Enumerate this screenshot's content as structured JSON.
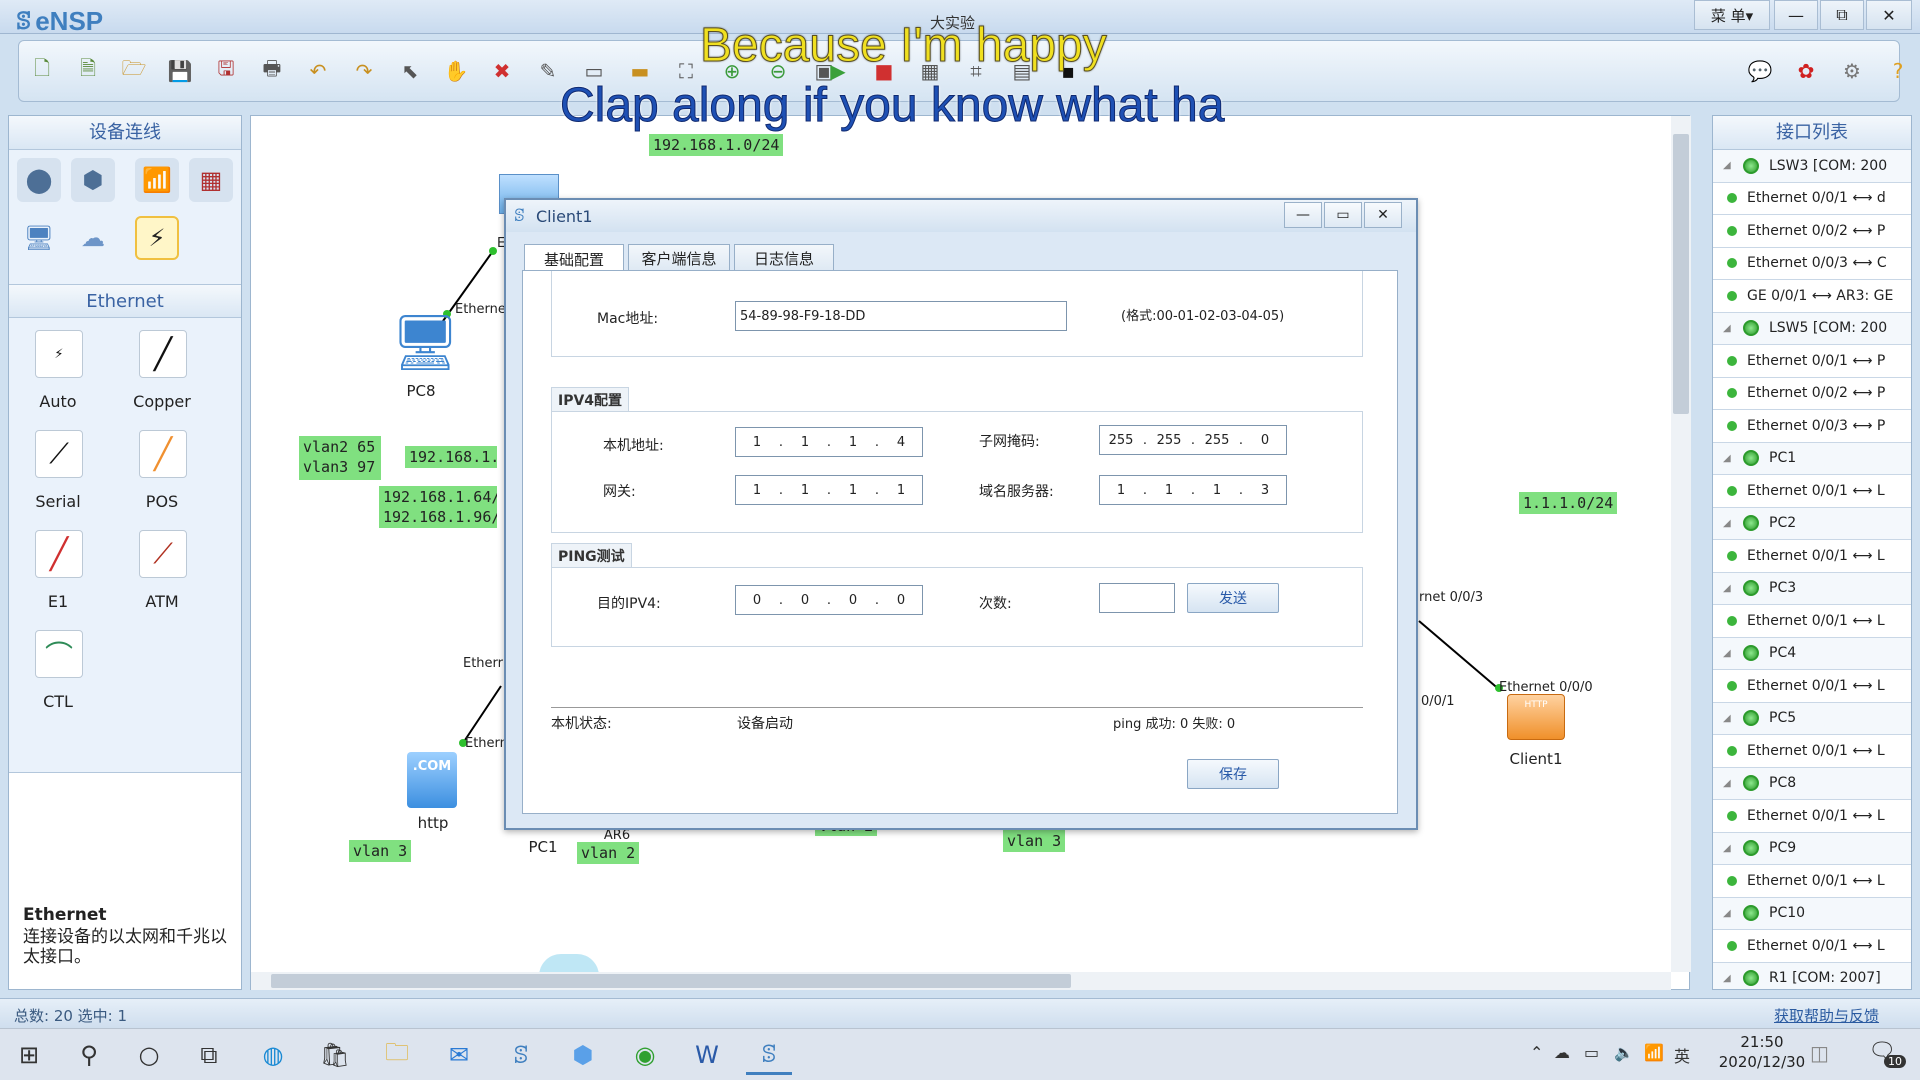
{
  "app": {
    "name": "eNSP",
    "window_title": "大实验",
    "menu_label": "菜 单▾"
  },
  "subtitles": {
    "line1": "Because I'm happy",
    "line2": "Clap along if you know what ha"
  },
  "left_panel": {
    "devices_title": "设备连线",
    "devices": [
      {
        "name": "router-icon"
      },
      {
        "name": "switch-icon"
      },
      {
        "name": "wireless-icon"
      },
      {
        "name": "firewall-icon"
      },
      {
        "name": "pc-icon"
      },
      {
        "name": "cloud-icon"
      },
      {
        "name": "cable-icon"
      }
    ],
    "cables_title": "Ethernet",
    "cables": [
      "Auto",
      "Copper",
      "Serial",
      "POS",
      "E1",
      "ATM",
      "CTL"
    ],
    "desc_title": "Ethernet",
    "desc_text": "连接设备的以太网和千兆以太接口。"
  },
  "canvas": {
    "labels": {
      "net_top": "192.168.1.0/24",
      "vlan_a": "vlan2 65",
      "vlan_b": "vlan3 97",
      "ip_mid": "192.168.1.",
      "ip_64": "192.168.1.64/",
      "ip_96": "192.168.1.96/",
      "net_right": "1.1.1.0/24",
      "vlan3_left": "vlan 3",
      "vlan2_bottom": "vlan 2",
      "vlan2_partial": "vlan 2",
      "vlan3_mid": "vlan 3"
    },
    "nodes": {
      "pc8": "PC8",
      "http": "http",
      "pc1": "PC1",
      "ar6": "AR6",
      "client1": "Client1",
      "http_badge": "HTTP",
      "com_badge": ".COM"
    },
    "ports": {
      "p1": "Etherne",
      "p2": "Etherr",
      "p3": "Ethern",
      "p4": "rnet 0/0/3",
      "p5": "Ethernet 0/0/0",
      "p6": "0/0/1",
      "p7": "E"
    }
  },
  "dialog": {
    "title": "Client1",
    "tabs": [
      "基础配置",
      "客户端信息",
      "日志信息"
    ],
    "mac_label": "Mac地址:",
    "mac_value": "54-89-98-F9-18-DD",
    "mac_hint": "(格式:00-01-02-03-04-05)",
    "ipv4_title": "IPV4配置",
    "ip_label": "本机地址:",
    "ip_value": [
      "1",
      "1",
      "1",
      "4"
    ],
    "mask_label": "子网掩码:",
    "mask_value": [
      "255",
      "255",
      "255",
      "0"
    ],
    "gw_label": "网关:",
    "gw_value": [
      "1",
      "1",
      "1",
      "1"
    ],
    "dns_label": "域名服务器:",
    "dns_value": [
      "1",
      "1",
      "1",
      "3"
    ],
    "ping_title": "PING测试",
    "target_label": "目的IPV4:",
    "target_value": [
      "0",
      "0",
      "0",
      "0"
    ],
    "count_label": "次数:",
    "count_value": "",
    "send_label": "发送",
    "status_label": "本机状态:",
    "status_value": "设备启动",
    "ping_result": "ping 成功: 0  失败: 0",
    "save_label": "保存"
  },
  "right_panel": {
    "title": "接口列表",
    "items": [
      {
        "type": "device",
        "label": "LSW3 [COM: 200"
      },
      {
        "type": "port",
        "label": "Ethernet 0/0/1  ⟷  d"
      },
      {
        "type": "port",
        "label": "Ethernet 0/0/2  ⟷  P"
      },
      {
        "type": "port",
        "label": "Ethernet 0/0/3  ⟷  C"
      },
      {
        "type": "port",
        "label": "GE 0/0/1  ⟷  AR3: GE"
      },
      {
        "type": "device",
        "label": "LSW5 [COM: 200"
      },
      {
        "type": "port",
        "label": "Ethernet 0/0/1  ⟷  P"
      },
      {
        "type": "port",
        "label": "Ethernet 0/0/2  ⟷  P"
      },
      {
        "type": "port",
        "label": "Ethernet 0/0/3  ⟷  P"
      },
      {
        "type": "device",
        "label": "PC1"
      },
      {
        "type": "port",
        "label": "Ethernet 0/0/1  ⟷  L"
      },
      {
        "type": "device",
        "label": "PC2"
      },
      {
        "type": "port",
        "label": "Ethernet 0/0/1  ⟷  L"
      },
      {
        "type": "device",
        "label": "PC3"
      },
      {
        "type": "port",
        "label": "Ethernet 0/0/1  ⟷  L"
      },
      {
        "type": "device",
        "label": "PC4"
      },
      {
        "type": "port",
        "label": "Ethernet 0/0/1  ⟷  L"
      },
      {
        "type": "device",
        "label": "PC5"
      },
      {
        "type": "port",
        "label": "Ethernet 0/0/1  ⟷  L"
      },
      {
        "type": "device",
        "label": "PC8"
      },
      {
        "type": "port",
        "label": "Ethernet 0/0/1  ⟷  L"
      },
      {
        "type": "device",
        "label": "PC9"
      },
      {
        "type": "port",
        "label": "Ethernet 0/0/1  ⟷  L"
      },
      {
        "type": "device",
        "label": "PC10"
      },
      {
        "type": "port",
        "label": "Ethernet 0/0/1  ⟷  L"
      },
      {
        "type": "device",
        "label": "R1 [COM: 2007]"
      }
    ]
  },
  "statusbar": {
    "summary": "总数: 20  选中: 1",
    "help_link": "获取帮助与反馈"
  },
  "taskbar": {
    "time": "21:50",
    "date": "2020/12/30",
    "ime": "英",
    "notification_count": "10"
  },
  "colors": {
    "accent": "#3f7fbf",
    "label_green": "#80e080",
    "status_green": "#3cb53c"
  }
}
